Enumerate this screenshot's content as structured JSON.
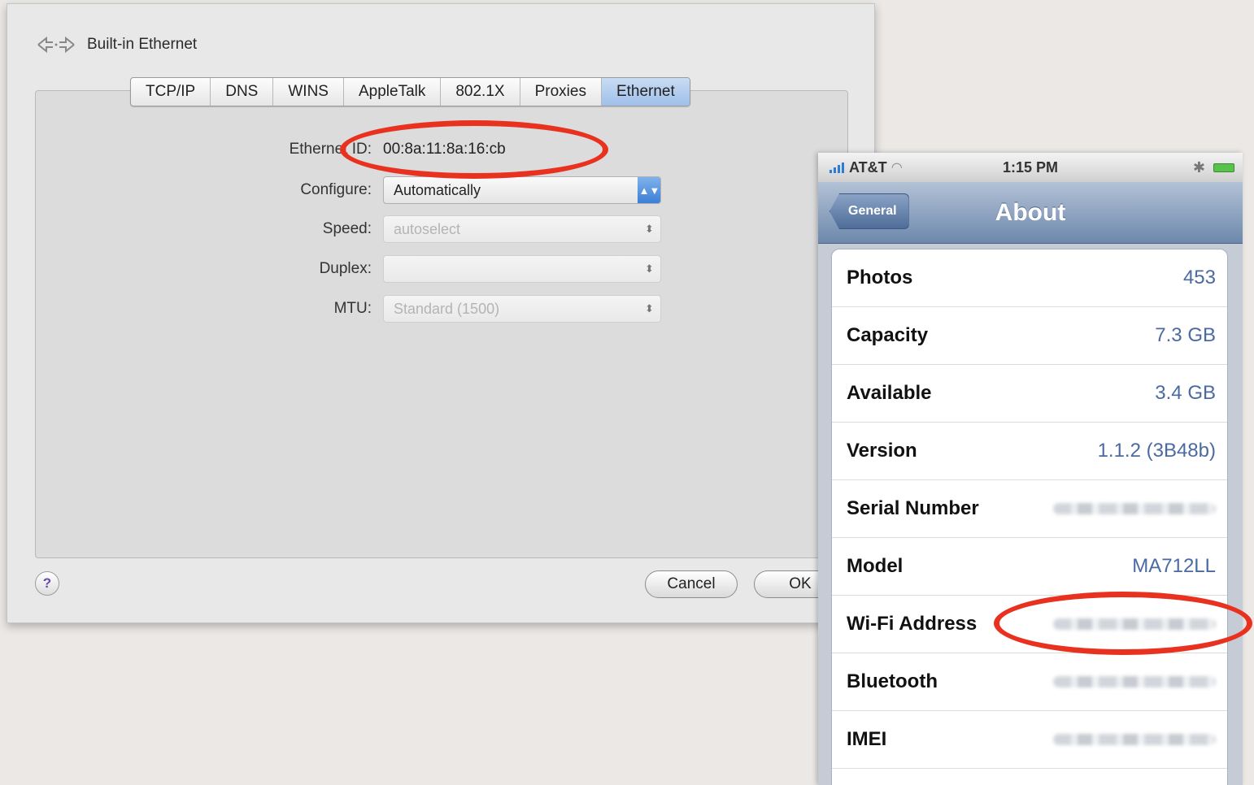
{
  "sheet": {
    "title": "Built-in Ethernet",
    "icon": "ethernet-arrows-icon",
    "tabs": [
      "TCP/IP",
      "DNS",
      "WINS",
      "AppleTalk",
      "802.1X",
      "Proxies",
      "Ethernet"
    ],
    "selected_tab": "Ethernet",
    "fields": {
      "ethernet_id_label": "Ethernet ID:",
      "ethernet_id_value": "00:8a:11:8a:16:cb",
      "configure_label": "Configure:",
      "configure_value": "Automatically",
      "speed_label": "Speed:",
      "speed_value": "autoselect",
      "duplex_label": "Duplex:",
      "duplex_value": "",
      "mtu_label": "MTU:",
      "mtu_value": "Standard (1500)"
    },
    "help_label": "?",
    "cancel_label": "Cancel",
    "ok_label": "OK"
  },
  "phone": {
    "carrier": "AT&T",
    "time": "1:15 PM",
    "back_label": "General",
    "title": "About",
    "rows": [
      {
        "key": "Photos",
        "value": "453"
      },
      {
        "key": "Capacity",
        "value": "7.3 GB"
      },
      {
        "key": "Available",
        "value": "3.4 GB"
      },
      {
        "key": "Version",
        "value": "1.1.2 (3B48b)"
      },
      {
        "key": "Serial Number",
        "value": ""
      },
      {
        "key": "Model",
        "value": "MA712LL"
      },
      {
        "key": "Wi-Fi Address",
        "value": ""
      },
      {
        "key": "Bluetooth",
        "value": ""
      },
      {
        "key": "IMEI",
        "value": ""
      }
    ]
  },
  "colors": {
    "annotation": "#e8321f",
    "selected_tab": "#a9c7ec",
    "phone_value": "#4a6aa0"
  }
}
